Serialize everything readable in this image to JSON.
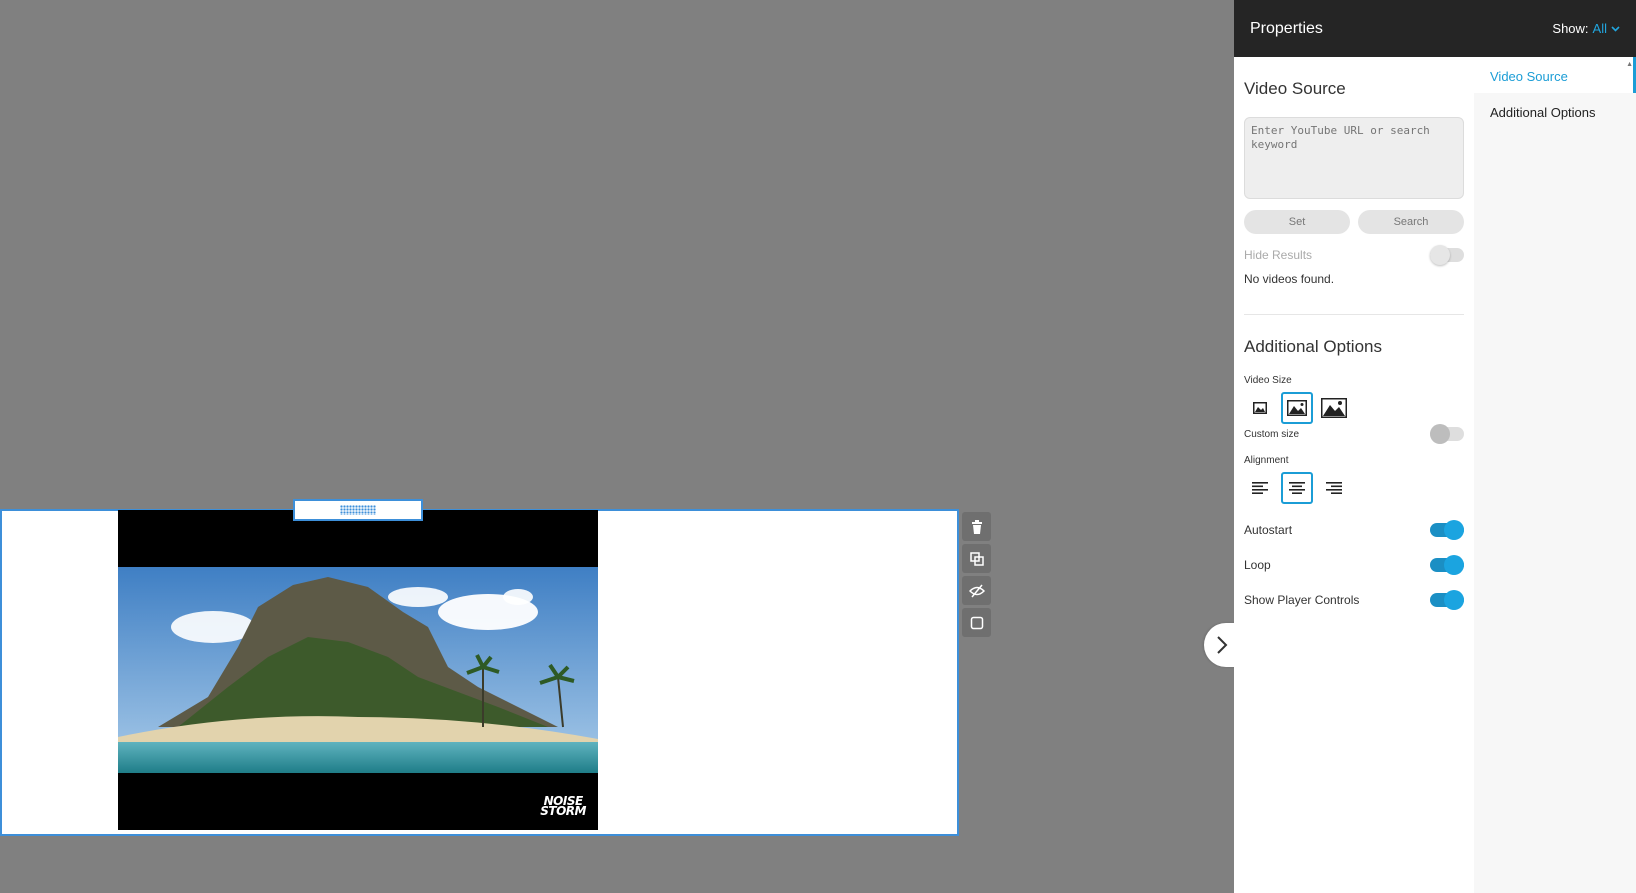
{
  "panel": {
    "title": "Properties",
    "show_label": "Show:",
    "show_value": "All",
    "nav": [
      {
        "label": "Video Source",
        "active": true
      },
      {
        "label": "Additional Options",
        "active": false
      }
    ]
  },
  "video_source": {
    "heading": "Video Source",
    "input_value": "",
    "input_placeholder": "Enter YouTube URL or search keyword",
    "set_label": "Set",
    "search_label": "Search",
    "hide_results_label": "Hide Results",
    "hide_results_on": false,
    "results_text": "No videos found."
  },
  "additional_options": {
    "heading": "Additional Options",
    "video_size_label": "Video Size",
    "video_sizes": [
      "small-image-icon",
      "medium-image-icon",
      "large-image-icon"
    ],
    "video_size_selected": 1,
    "custom_size_label": "Custom size",
    "custom_size_on": false,
    "alignment_label": "Alignment",
    "alignments": [
      "align-left-icon",
      "align-center-icon",
      "align-right-icon"
    ],
    "alignment_selected": 1,
    "autostart_label": "Autostart",
    "autostart_on": true,
    "loop_label": "Loop",
    "loop_on": true,
    "controls_label": "Show Player Controls",
    "controls_on": true
  },
  "video": {
    "watermark_line1": "NOISE",
    "watermark_line2": "STORM"
  },
  "block_tools": [
    "trash-icon",
    "duplicate-icon",
    "hide-icon",
    "square-icon"
  ],
  "colors": {
    "accent": "#1b9dd6",
    "selection_border": "#3d8fd9",
    "panel_header": "#252525",
    "canvas_bg": "#808080"
  }
}
